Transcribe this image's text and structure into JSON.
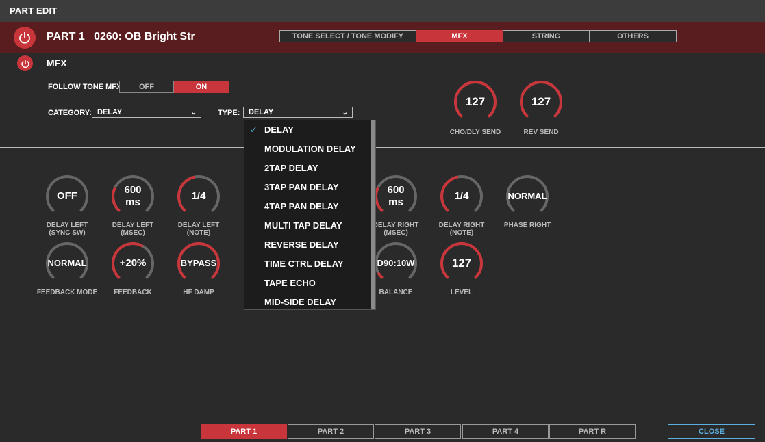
{
  "window": {
    "title": "PART EDIT"
  },
  "part": {
    "number": "PART 1",
    "tone": "0260: OB Bright Str"
  },
  "tabs": [
    {
      "label": "TONE SELECT / TONE MODIFY",
      "active": false
    },
    {
      "label": "MFX",
      "active": true
    },
    {
      "label": "STRING",
      "active": false
    },
    {
      "label": "OTHERS",
      "active": false
    }
  ],
  "mfx": {
    "title": "MFX",
    "follow_label": "FOLLOW TONE MFX:",
    "follow_off": "OFF",
    "follow_on": "ON",
    "follow_value": "ON",
    "category_label": "CATEGORY:",
    "category_value": "DELAY",
    "type_label": "TYPE:",
    "type_value": "DELAY"
  },
  "sends": [
    {
      "label": "CHO/DLY SEND",
      "value": "127",
      "level": 1.0
    },
    {
      "label": "REV SEND",
      "value": "127",
      "level": 1.0
    }
  ],
  "params_row1": [
    {
      "label1": "DELAY LEFT",
      "label2": "(SYNC SW)",
      "value": "OFF",
      "level": 0.0
    },
    {
      "label1": "DELAY LEFT",
      "label2": "(MSEC)",
      "value": "600",
      "unit": "ms",
      "level": 0.25
    },
    {
      "label1": "DELAY LEFT",
      "label2": "(NOTE)",
      "value": "1/4",
      "level": 0.45
    },
    {
      "label1": "DELAY RIGHT",
      "label2": "(MSEC)",
      "value": "600",
      "unit": "ms",
      "level": 0.25
    },
    {
      "label1": "DELAY RIGHT",
      "label2": "(NOTE)",
      "value": "1/4",
      "level": 0.45
    },
    {
      "label1": "PHASE RIGHT",
      "label2": "",
      "value": "NORMAL",
      "level": 0.0
    }
  ],
  "params_row2": [
    {
      "label1": "FEEDBACK MODE",
      "value": "NORMAL",
      "level": 0.0
    },
    {
      "label1": "FEEDBACK",
      "value": "+20%",
      "level": 0.6
    },
    {
      "label1": "HF DAMP",
      "value": "BYPASS",
      "level": 1.0
    },
    {
      "label1": "BALANCE",
      "value": "D90:10W",
      "level": 0.05
    },
    {
      "label1": "LEVEL",
      "value": "127",
      "level": 1.0
    }
  ],
  "type_dropdown": {
    "selected": "DELAY",
    "items": [
      "DELAY",
      "MODULATION DELAY",
      "2TAP DELAY",
      "3TAP PAN DELAY",
      "4TAP PAN DELAY",
      "MULTI TAP DELAY",
      "REVERSE DELAY",
      "TIME CTRL DELAY",
      "TAPE ECHO",
      "MID-SIDE DELAY"
    ]
  },
  "part_tabs": [
    {
      "label": "PART 1",
      "active": true
    },
    {
      "label": "PART 2",
      "active": false
    },
    {
      "label": "PART 3",
      "active": false
    },
    {
      "label": "PART 4",
      "active": false
    },
    {
      "label": "PART R",
      "active": false
    }
  ],
  "close_label": "CLOSE",
  "colors": {
    "accent": "#c8353a",
    "highlight": "#5bb0e0",
    "track": "#666666"
  }
}
